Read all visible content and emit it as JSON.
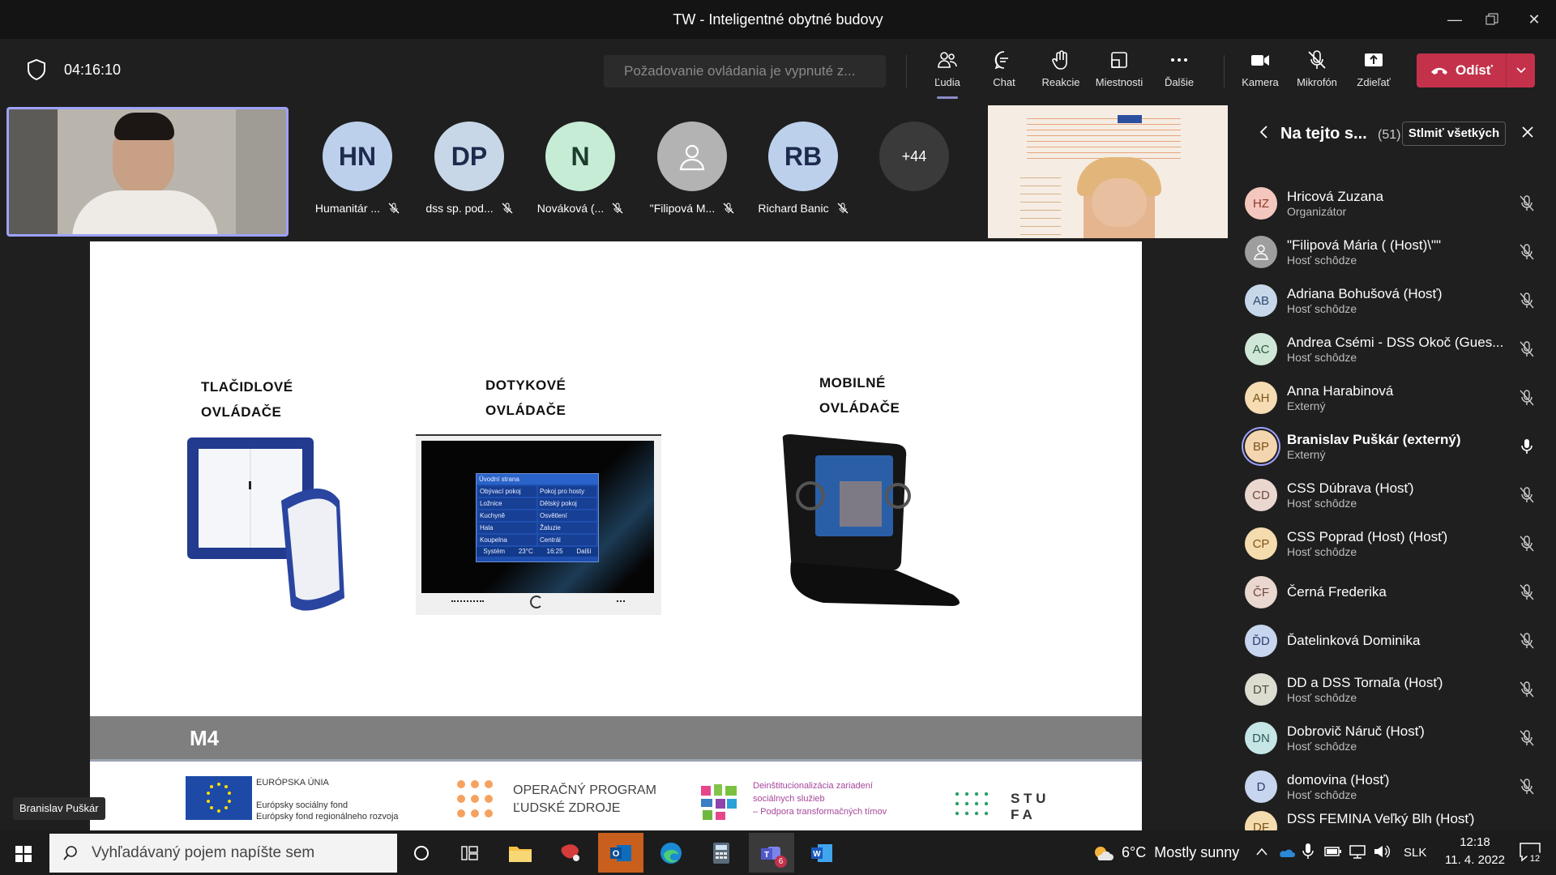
{
  "window": {
    "title": "TW - Inteligentné obytné budovy"
  },
  "meeting": {
    "timer": "04:16:10",
    "control_request_placeholder": "Požadovanie ovládania je vypnuté z...",
    "toolbar": [
      {
        "label": "Ľudia",
        "icon": "people-icon",
        "active": true
      },
      {
        "label": "Chat",
        "icon": "chat-icon"
      },
      {
        "label": "Reakcie",
        "icon": "reactions-icon"
      },
      {
        "label": "Miestnosti",
        "icon": "rooms-icon"
      },
      {
        "label": "Ďalšie",
        "icon": "more-icon"
      },
      {
        "label": "Kamera",
        "icon": "camera-icon"
      },
      {
        "label": "Mikrofón",
        "icon": "mic-off-icon"
      },
      {
        "label": "Zdieľať",
        "icon": "share-icon"
      }
    ],
    "leave_label": "Odísť",
    "accent": "#c4314b"
  },
  "gallery": {
    "tiles": [
      {
        "initials": "HN",
        "name": "Humanitár ...",
        "color": "#bcd0ec"
      },
      {
        "initials": "DP",
        "name": "dss sp. pod...",
        "color": "#c7d7e7"
      },
      {
        "initials": "N",
        "name": "Nováková (...",
        "color": "#c6ecd6"
      },
      {
        "initials": "",
        "name": "\"Filipová M...",
        "color": "#b3b3b3"
      },
      {
        "initials": "RB",
        "name": "Richard Banic",
        "color": "#bcd0ec"
      }
    ],
    "more": "+44",
    "speaker_label": "Branislav Puškár"
  },
  "slide": {
    "col1": [
      "TLAČIDLOVÉ",
      "OVLÁDAČE"
    ],
    "col2": [
      "DOTYKOVÉ",
      "OVLÁDAČE"
    ],
    "col3": [
      "MOBILNÉ",
      "OVLÁDAČE"
    ],
    "touch_menu": [
      "Úvodní strana",
      "Obývací pokoj",
      "Pokoj pro hosty",
      "Ložnice",
      "Dětský pokoj",
      "Kuchyně",
      "Osvětlení",
      "Hala",
      "Žaluzie",
      "Koupelna",
      "Centrál",
      "Systém",
      "23°C",
      "16:25",
      "Další"
    ],
    "footer_title": "M4",
    "logo_eu": {
      "title": "EURÓPSKA ÚNIA",
      "line1": "Európsky sociálny fond",
      "line2": "Európsky fond regionálneho rozvoja"
    },
    "logo_op": {
      "line1": "OPERAČNÝ PROGRAM",
      "line2": "ĽUDSKÉ ZDROJE"
    },
    "logo_di": {
      "line1": "Deinštitucionalizácia zariadení",
      "line2": "sociálnych služieb",
      "line3": "– Podpora transformačných tímov"
    },
    "logo_stu": {
      "line1": "S T U",
      "line2": "F A"
    }
  },
  "panel": {
    "title": "Na tejto s...",
    "count": "(51)",
    "mute_all": "Stlmiť všetkých",
    "participants": [
      {
        "initials": "HZ",
        "name": "Hricová Zuzana",
        "role": "Organizátor",
        "color": "#f4c7be",
        "muted": true
      },
      {
        "initials": "",
        "name": "\"Filipová Mária ( (Host)\\\"\"",
        "role": "Hosť schôdze",
        "color": "#9e9e9e",
        "muted": true
      },
      {
        "initials": "AB",
        "name": "Adriana Bohušová (Hosť)",
        "role": "Hosť schôdze",
        "color": "#c7d7ea",
        "muted": true
      },
      {
        "initials": "AC",
        "name": "Andrea Csémi - DSS Okoč (Gues...",
        "role": "Hosť schôdze",
        "color": "#cfe7d6",
        "muted": true
      },
      {
        "initials": "AH",
        "name": "Anna Harabinová",
        "role": "Externý",
        "color": "#f5dcb2",
        "muted": true
      },
      {
        "initials": "BP",
        "name": "Branislav Puškár (externý)",
        "role": "Externý",
        "color": "#f3d5b0",
        "muted": false,
        "bold": true
      },
      {
        "initials": "CD",
        "name": "CSS Dúbrava (Hosť)",
        "role": "Hosť schôdze",
        "color": "#ead7cf",
        "muted": true
      },
      {
        "initials": "CP",
        "name": "CSS Poprad (Host) (Hosť)",
        "role": "Hosť schôdze",
        "color": "#f5dcae",
        "muted": true
      },
      {
        "initials": "ČF",
        "name": "Černá Frederika",
        "role": "",
        "color": "#ead7cf",
        "muted": true
      },
      {
        "initials": "ĎD",
        "name": "Ďatelinková Dominika",
        "role": "",
        "color": "#c8d5ee",
        "muted": true
      },
      {
        "initials": "DT",
        "name": "DD a DSS Tornaľa (Hosť)",
        "role": "Hosť schôdze",
        "color": "#dcdcd0",
        "muted": true
      },
      {
        "initials": "DN",
        "name": "Dobrovič Náruč (Hosť)",
        "role": "Hosť schôdze",
        "color": "#c6e6e6",
        "muted": true
      },
      {
        "initials": "D",
        "name": "domovina (Hosť)",
        "role": "Hosť schôdze",
        "color": "#c8d5ee",
        "muted": true
      },
      {
        "initials": "DF",
        "name": "DSS FEMINA Veľký Blh (Hosť)",
        "role": "",
        "color": "#f5dcae",
        "muted": true
      }
    ]
  },
  "taskbar": {
    "search_placeholder": "Vyhľadávaný pojem napíšte sem",
    "weather": "6°C  Mostly sunny",
    "lang": "SLK",
    "time": "12:18",
    "date": "11. 4. 2022",
    "teams_badge": "6",
    "notif_count": "12"
  }
}
